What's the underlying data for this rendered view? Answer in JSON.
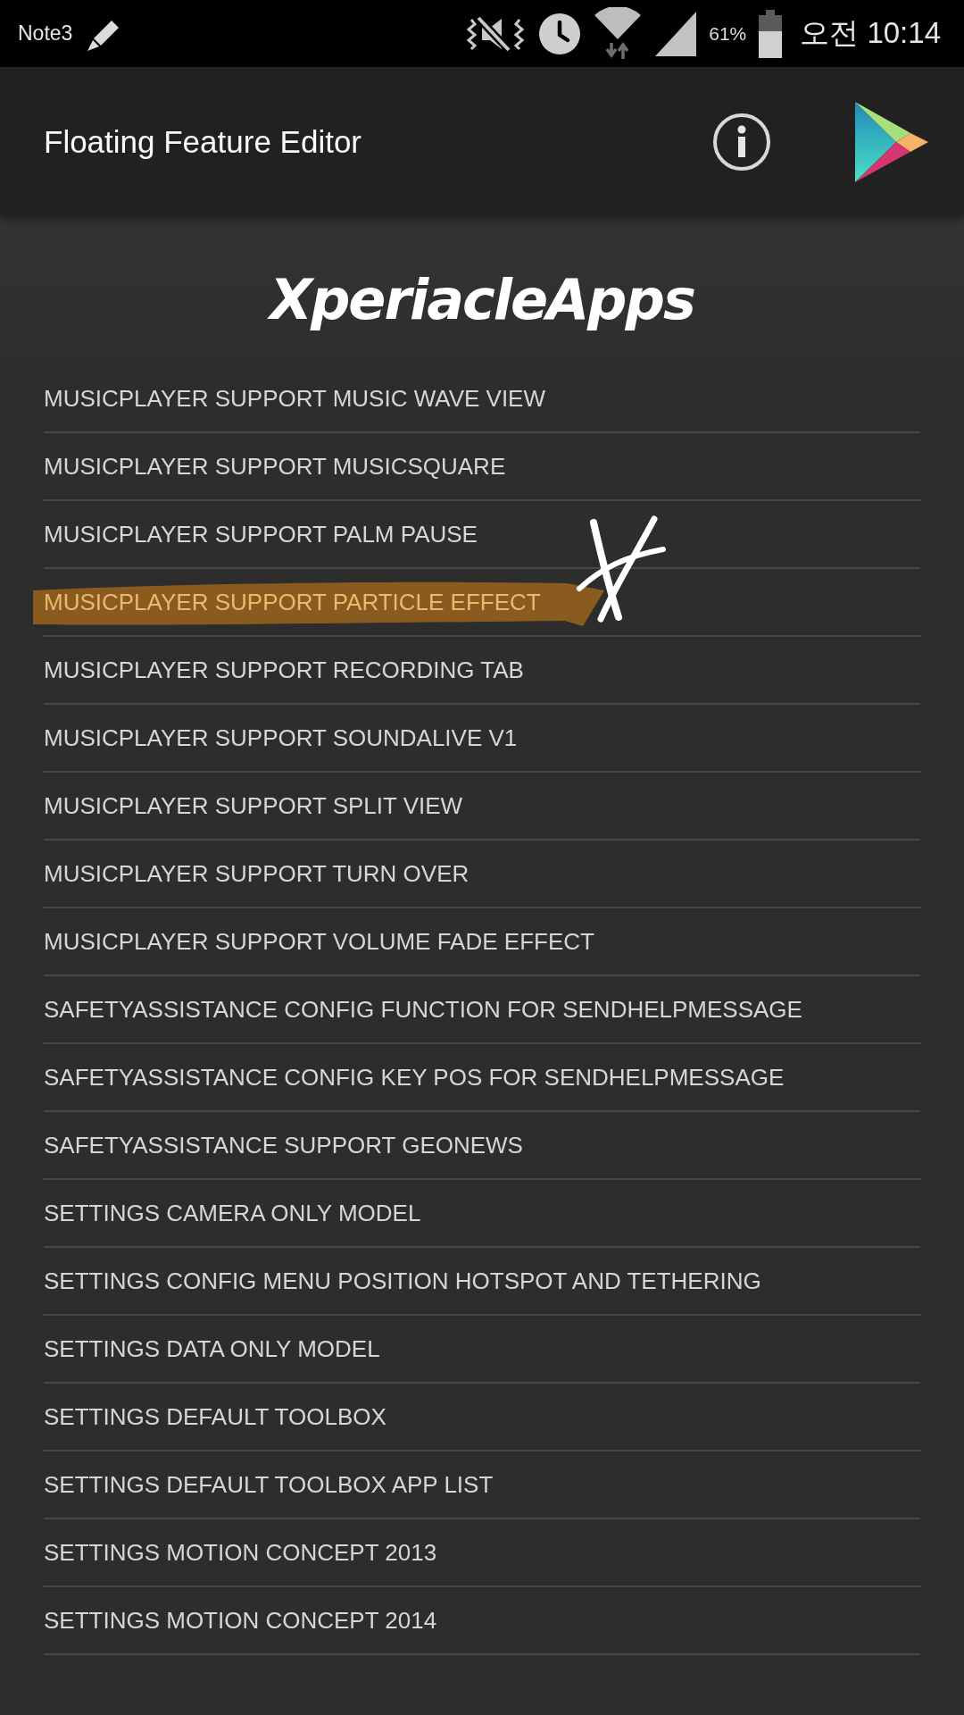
{
  "status_bar": {
    "device_label": "Note3",
    "battery_percent": "61%",
    "time": "오전 10:14"
  },
  "app_bar": {
    "title": "Floating Feature Editor"
  },
  "banner": {
    "text": "XperiacleApps"
  },
  "features": [
    {
      "label": "MUSICPLAYER SUPPORT MUSIC WAVE VIEW",
      "highlighted": false,
      "crossed": false
    },
    {
      "label": "MUSICPLAYER SUPPORT MUSICSQUARE",
      "highlighted": false,
      "crossed": false
    },
    {
      "label": "MUSICPLAYER SUPPORT PALM PAUSE",
      "highlighted": false,
      "crossed": false
    },
    {
      "label": "MUSICPLAYER SUPPORT PARTICLE EFFECT",
      "highlighted": true,
      "crossed": true
    },
    {
      "label": "MUSICPLAYER SUPPORT RECORDING TAB",
      "highlighted": false,
      "crossed": false
    },
    {
      "label": "MUSICPLAYER SUPPORT SOUNDALIVE V1",
      "highlighted": false,
      "crossed": false
    },
    {
      "label": "MUSICPLAYER SUPPORT SPLIT VIEW",
      "highlighted": false,
      "crossed": false
    },
    {
      "label": "MUSICPLAYER SUPPORT TURN OVER",
      "highlighted": false,
      "crossed": false
    },
    {
      "label": "MUSICPLAYER SUPPORT VOLUME FADE EFFECT",
      "highlighted": false,
      "crossed": false
    },
    {
      "label": "SAFETYASSISTANCE CONFIG FUNCTION FOR SENDHELPMESSAGE",
      "highlighted": false,
      "crossed": false
    },
    {
      "label": "SAFETYASSISTANCE CONFIG KEY POS FOR SENDHELPMESSAGE",
      "highlighted": false,
      "crossed": false
    },
    {
      "label": "SAFETYASSISTANCE SUPPORT GEONEWS",
      "highlighted": false,
      "crossed": false
    },
    {
      "label": "SETTINGS CAMERA ONLY MODEL",
      "highlighted": false,
      "crossed": false
    },
    {
      "label": "SETTINGS CONFIG MENU POSITION HOTSPOT AND TETHERING",
      "highlighted": false,
      "crossed": false
    },
    {
      "label": "SETTINGS DATA ONLY MODEL",
      "highlighted": false,
      "crossed": false
    },
    {
      "label": "SETTINGS DEFAULT TOOLBOX",
      "highlighted": false,
      "crossed": false
    },
    {
      "label": "SETTINGS DEFAULT TOOLBOX APP LIST",
      "highlighted": false,
      "crossed": false
    },
    {
      "label": "SETTINGS MOTION CONCEPT 2013",
      "highlighted": false,
      "crossed": false
    },
    {
      "label": "SETTINGS MOTION CONCEPT 2014",
      "highlighted": false,
      "crossed": false
    }
  ]
}
